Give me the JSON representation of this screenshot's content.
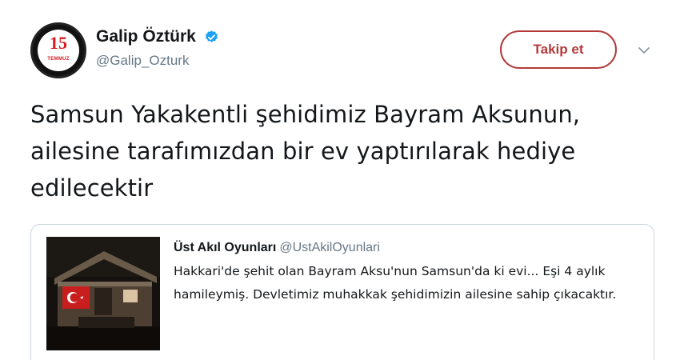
{
  "tweet": {
    "author": {
      "display_name": "Galip Öztürk",
      "handle": "@Galip_Ozturk",
      "verified": true,
      "avatar": {
        "number": "15",
        "caption": "TEMMUZ",
        "accent": "#d71920"
      }
    },
    "follow_label": "Takip et",
    "accent_color": "#b33a3a",
    "text": "Samsun Yakakentli şehidimiz Bayram Aksunun, ailesine tarafımızdan bir ev yaptırılarak hediye edilecektir",
    "quoted": {
      "display_name": "Üst Akıl Oyunları",
      "handle": "@UstAkilOyunlari",
      "text": "Hakkari'de şehit olan Bayram Aksu'nun Samsun'da ki evi... Eşi 4 aylık hamileymiş. Devletimiz muhakkak şehidimizin ailesine sahip çıkacaktır."
    }
  }
}
